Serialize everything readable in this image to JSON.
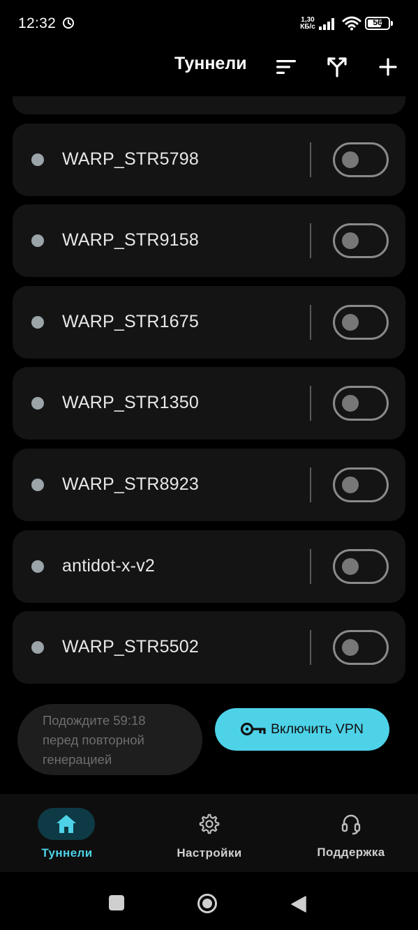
{
  "status_bar": {
    "time": "12:32",
    "network_speed_value": "1,30",
    "network_speed_unit": "КБ/с",
    "battery_level": "56",
    "icons": [
      "clock-icon",
      "signal-icon",
      "wifi-icon",
      "battery-icon"
    ]
  },
  "header": {
    "title": "Туннели",
    "actions": [
      "sort-icon",
      "route-split-icon",
      "add-icon"
    ]
  },
  "tunnels": [
    {
      "name": "WARP_STR5798",
      "enabled": false
    },
    {
      "name": "WARP_STR9158",
      "enabled": false
    },
    {
      "name": "WARP_STR1675",
      "enabled": false
    },
    {
      "name": "WARP_STR1350",
      "enabled": false
    },
    {
      "name": "WARP_STR8923",
      "enabled": false
    },
    {
      "name": "antidot-x-v2",
      "enabled": false
    },
    {
      "name": "WARP_STR5502",
      "enabled": false
    }
  ],
  "actions": {
    "wait_lines": [
      "Подождите 59:18",
      "перед повторной",
      "генерацией"
    ],
    "vpn_button": "Включить VPN"
  },
  "bottom_nav": {
    "items": [
      {
        "label": "Туннели",
        "icon": "home-icon",
        "active": true
      },
      {
        "label": "Настройки",
        "icon": "gear-icon",
        "active": false
      },
      {
        "label": "Поддержка",
        "icon": "headset-icon",
        "active": false
      }
    ]
  },
  "colors": {
    "accent": "#4dd2e8",
    "background": "#000000",
    "card": "#141414",
    "active_nav_pill": "#0d3a44"
  }
}
